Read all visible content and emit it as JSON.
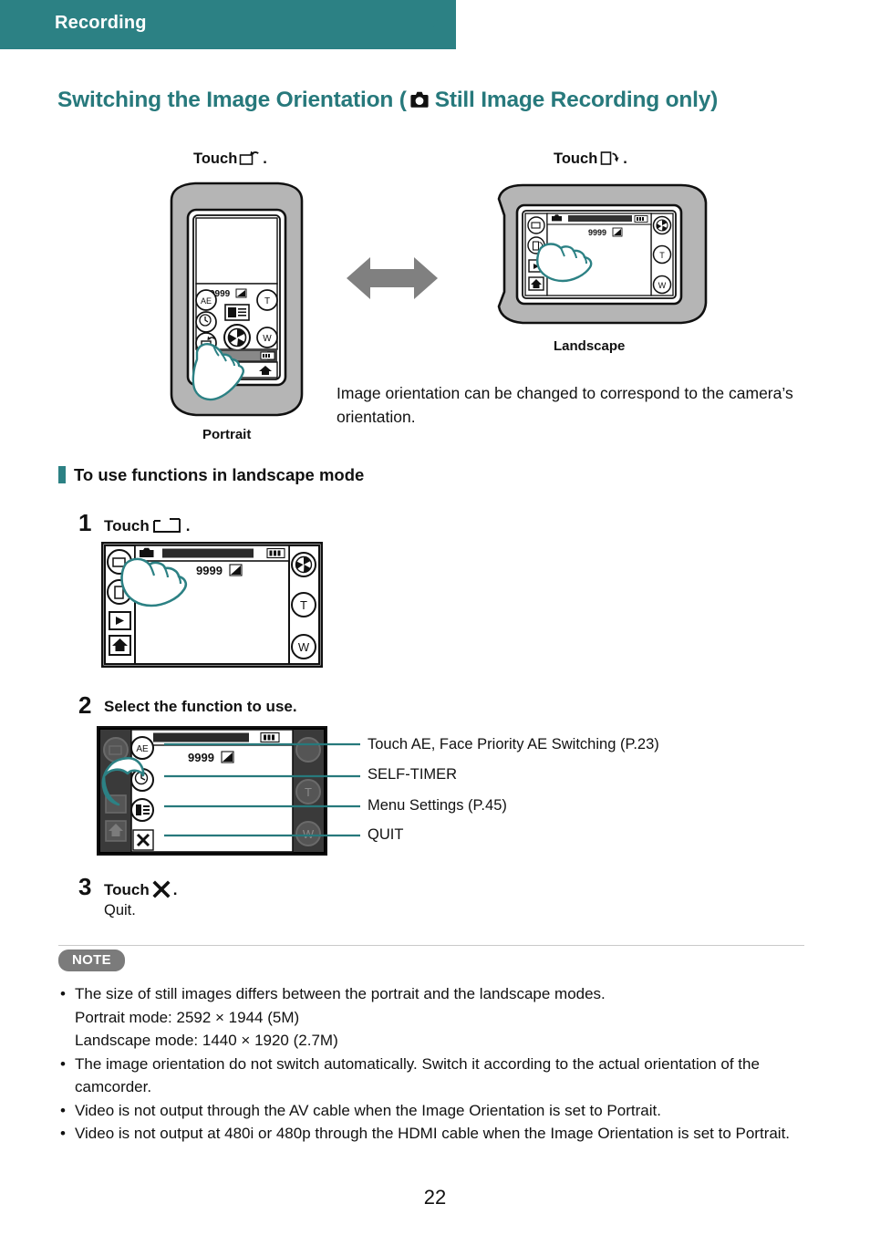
{
  "header": {
    "title": "Recording",
    "bar_color": "#2c8184"
  },
  "page": {
    "title_before": "Switching the Image Orientation (",
    "title_icon": "still-camera-icon",
    "title_after": "Still Image Recording only)",
    "title_color": "#27797c",
    "page_number": "22"
  },
  "diagram": {
    "touch_left_prefix": "Touch",
    "touch_left_icon": "rotate-to-landscape-icon",
    "touch_left_suffix": ".",
    "touch_right_prefix": "Touch",
    "touch_right_icon": "rotate-to-portrait-icon",
    "touch_right_suffix": ".",
    "caption_portrait": "Portrait",
    "caption_landscape": "Landscape",
    "arrow_icon": "double-headed-arrow-icon",
    "arrow_color": "#808080",
    "description": "Image orientation can be changed to correspond to the camera’s orientation.",
    "screen_counter": "9999"
  },
  "subsection": {
    "heading": "To use functions in landscape mode",
    "tick_color": "#2c8184"
  },
  "steps": [
    {
      "number": "1",
      "text_prefix": "Touch",
      "text_icon": "landscape-frame-icon",
      "text_suffix": "."
    },
    {
      "number": "2",
      "text_prefix": "Select the function to use.",
      "text_icon": "",
      "text_suffix": ""
    },
    {
      "number": "3",
      "text_prefix": "Touch",
      "text_icon": "cross-icon",
      "text_suffix": ".",
      "sub": "Quit."
    }
  ],
  "callouts": [
    {
      "label": "Touch AE, Face Priority AE Switching (P.23)",
      "icon": "ae-icon"
    },
    {
      "label": "SELF-TIMER",
      "icon": "self-timer-icon"
    },
    {
      "label": "Menu Settings (P.45)",
      "icon": "menu-icon"
    },
    {
      "label": "QUIT",
      "icon": "quit-cross-icon"
    }
  ],
  "note": {
    "badge": "NOTE",
    "badge_color": "#7b7b7b",
    "items": [
      {
        "text": "The size of still images differs between the portrait and the landscape modes.",
        "sublines": [
          "Portrait mode: 2592 × 1944 (5M)",
          "Landscape mode: 1440 × 1920 (2.7M)"
        ]
      },
      {
        "text": "The image orientation do not switch automatically. Switch it according to the actual orientation of the camcorder.",
        "sublines": []
      },
      {
        "text": "Video is not output through the AV cable when the Image Orientation is set to Portrait.",
        "sublines": []
      },
      {
        "text": "Video is not output at 480i or 480p through the HDMI cable when the Image Orientation is set to Portrait.",
        "sublines": []
      }
    ]
  }
}
